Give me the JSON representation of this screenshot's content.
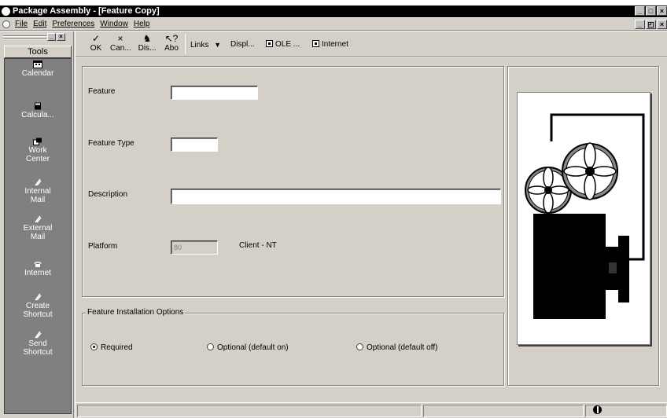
{
  "window": {
    "title": "Package Assembly - [Feature Copy]"
  },
  "menubar": {
    "items": [
      "File",
      "Edit",
      "Preferences",
      "Window",
      "Help"
    ]
  },
  "toolbar": {
    "buttons": [
      {
        "glyph": "✓",
        "label": "OK",
        "icon": "check-icon"
      },
      {
        "glyph": "×",
        "label": "Can...",
        "icon": "cancel-icon"
      },
      {
        "glyph": "♞",
        "label": "Dis...",
        "icon": "display-icon"
      },
      {
        "glyph": "↖?",
        "label": "Abo",
        "icon": "help-pointer-icon"
      }
    ],
    "links": [
      {
        "label": "Links",
        "icon": "dropdown-arrow-icon"
      },
      {
        "label": "Displ...",
        "icon": "dropdown-arrow-icon"
      },
      {
        "label": "OLE ...",
        "icon": "ole-icon"
      },
      {
        "label": "Internet",
        "icon": "internet-icon"
      }
    ]
  },
  "tools": {
    "header": "Tools",
    "items": [
      {
        "label": "Calendar",
        "icon": "calendar-icon"
      },
      {
        "label": "Calcula...",
        "icon": "calculator-icon"
      },
      {
        "label": "Work Center",
        "icon": "work-center-icon"
      },
      {
        "label": "Internal Mail",
        "icon": "internal-mail-icon"
      },
      {
        "label": "External Mail",
        "icon": "external-mail-icon"
      },
      {
        "label": "Internet",
        "icon": "phone-icon"
      },
      {
        "label": "Create Shortcut",
        "icon": "create-shortcut-icon"
      },
      {
        "label": "Send Shortcut",
        "icon": "send-shortcut-icon"
      }
    ]
  },
  "form": {
    "feature_label": "Feature",
    "feature_value": "",
    "feature_type_label": "Feature Type",
    "feature_type_value": "",
    "description_label": "Description",
    "description_value": "",
    "platform_label": "Platform",
    "platform_value": "80",
    "platform_desc": "Client - NT"
  },
  "install_options": {
    "legend": "Feature Installation Options",
    "options": [
      {
        "label": "Required",
        "selected": true
      },
      {
        "label": "Optional (default on)",
        "selected": false
      },
      {
        "label": "Optional (default off)",
        "selected": false
      }
    ]
  },
  "colors": {
    "face": "#d4d0c8",
    "tools_panel": "#808080",
    "title_bar": "#000000"
  }
}
